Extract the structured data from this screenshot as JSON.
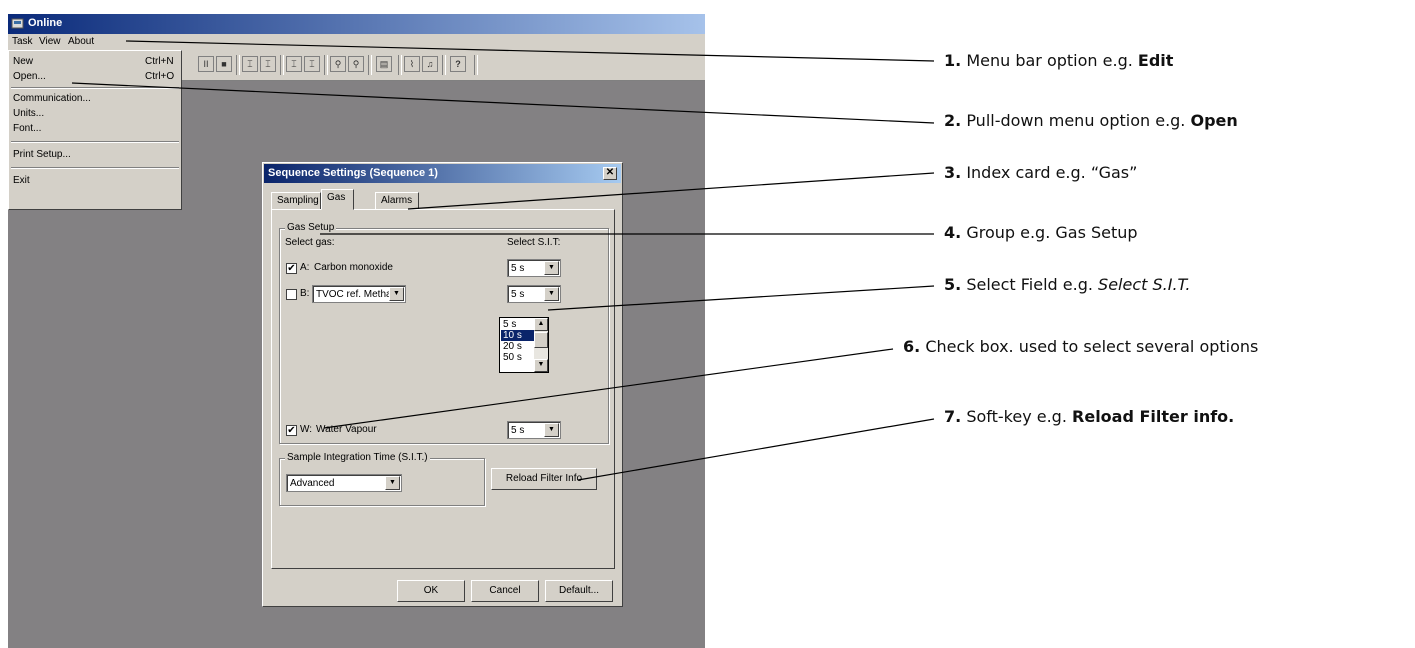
{
  "app": {
    "title": "Online",
    "menu": [
      "Task",
      "View",
      "About"
    ],
    "task_menu": {
      "items": [
        {
          "label": "New",
          "shortcut": "Ctrl+N"
        },
        {
          "label": "Open...",
          "shortcut": "Ctrl+O"
        },
        {
          "label": "Communication..."
        },
        {
          "label": "Units..."
        },
        {
          "label": "Font..."
        },
        {
          "label": "Print Setup..."
        },
        {
          "label": "Exit"
        }
      ]
    }
  },
  "dialog": {
    "title": "Sequence Settings (Sequence 1)",
    "close": "✕",
    "tabs": [
      "Sampling",
      "Gas",
      "Alarms"
    ],
    "gas_setup": {
      "label": "Gas Setup",
      "select_gas_label": "Select gas:",
      "select_sit_label": "Select S.I.T:",
      "rows": [
        {
          "checked": true,
          "prefix": "A:",
          "name": "Carbon monoxide",
          "sit": "5 s"
        },
        {
          "checked": false,
          "prefix": "B:",
          "name": "TVOC ref. Methane",
          "sit": "5 s"
        },
        {
          "checked": true,
          "prefix": "W:",
          "name": "Water Vapour",
          "sit": "5 s"
        }
      ],
      "sit_options": [
        "5 s",
        "10 s",
        "20 s",
        "50 s"
      ],
      "sit_highlighted": "10 s"
    },
    "sit_group": {
      "label": "Sample Integration Time (S.I.T.)",
      "value": "Advanced",
      "reload_button": "Reload Filter Info"
    },
    "buttons": {
      "ok": "OK",
      "cancel": "Cancel",
      "default": "Default..."
    }
  },
  "callouts": [
    {
      "num": "1.",
      "text": "Menu bar option e.g.",
      "emph": "Edit",
      "style": "bold"
    },
    {
      "num": "2.",
      "text": "Pull-down menu option e.g.",
      "emph": "Open",
      "style": "bold"
    },
    {
      "num": "3.",
      "text": "Index card e.g. “Gas”",
      "emph": "",
      "style": ""
    },
    {
      "num": "4.",
      "text": "Group e.g. Gas Setup",
      "emph": "",
      "style": ""
    },
    {
      "num": "5.",
      "text": "Select Field e.g.",
      "emph": "Select S.I.T.",
      "style": "italic"
    },
    {
      "num": "6.",
      "text": "Check box. used to select several options",
      "emph": "",
      "style": ""
    },
    {
      "num": "7.",
      "text": "Soft-key e.g.",
      "emph": "Reload Filter info.",
      "style": "bold"
    }
  ]
}
